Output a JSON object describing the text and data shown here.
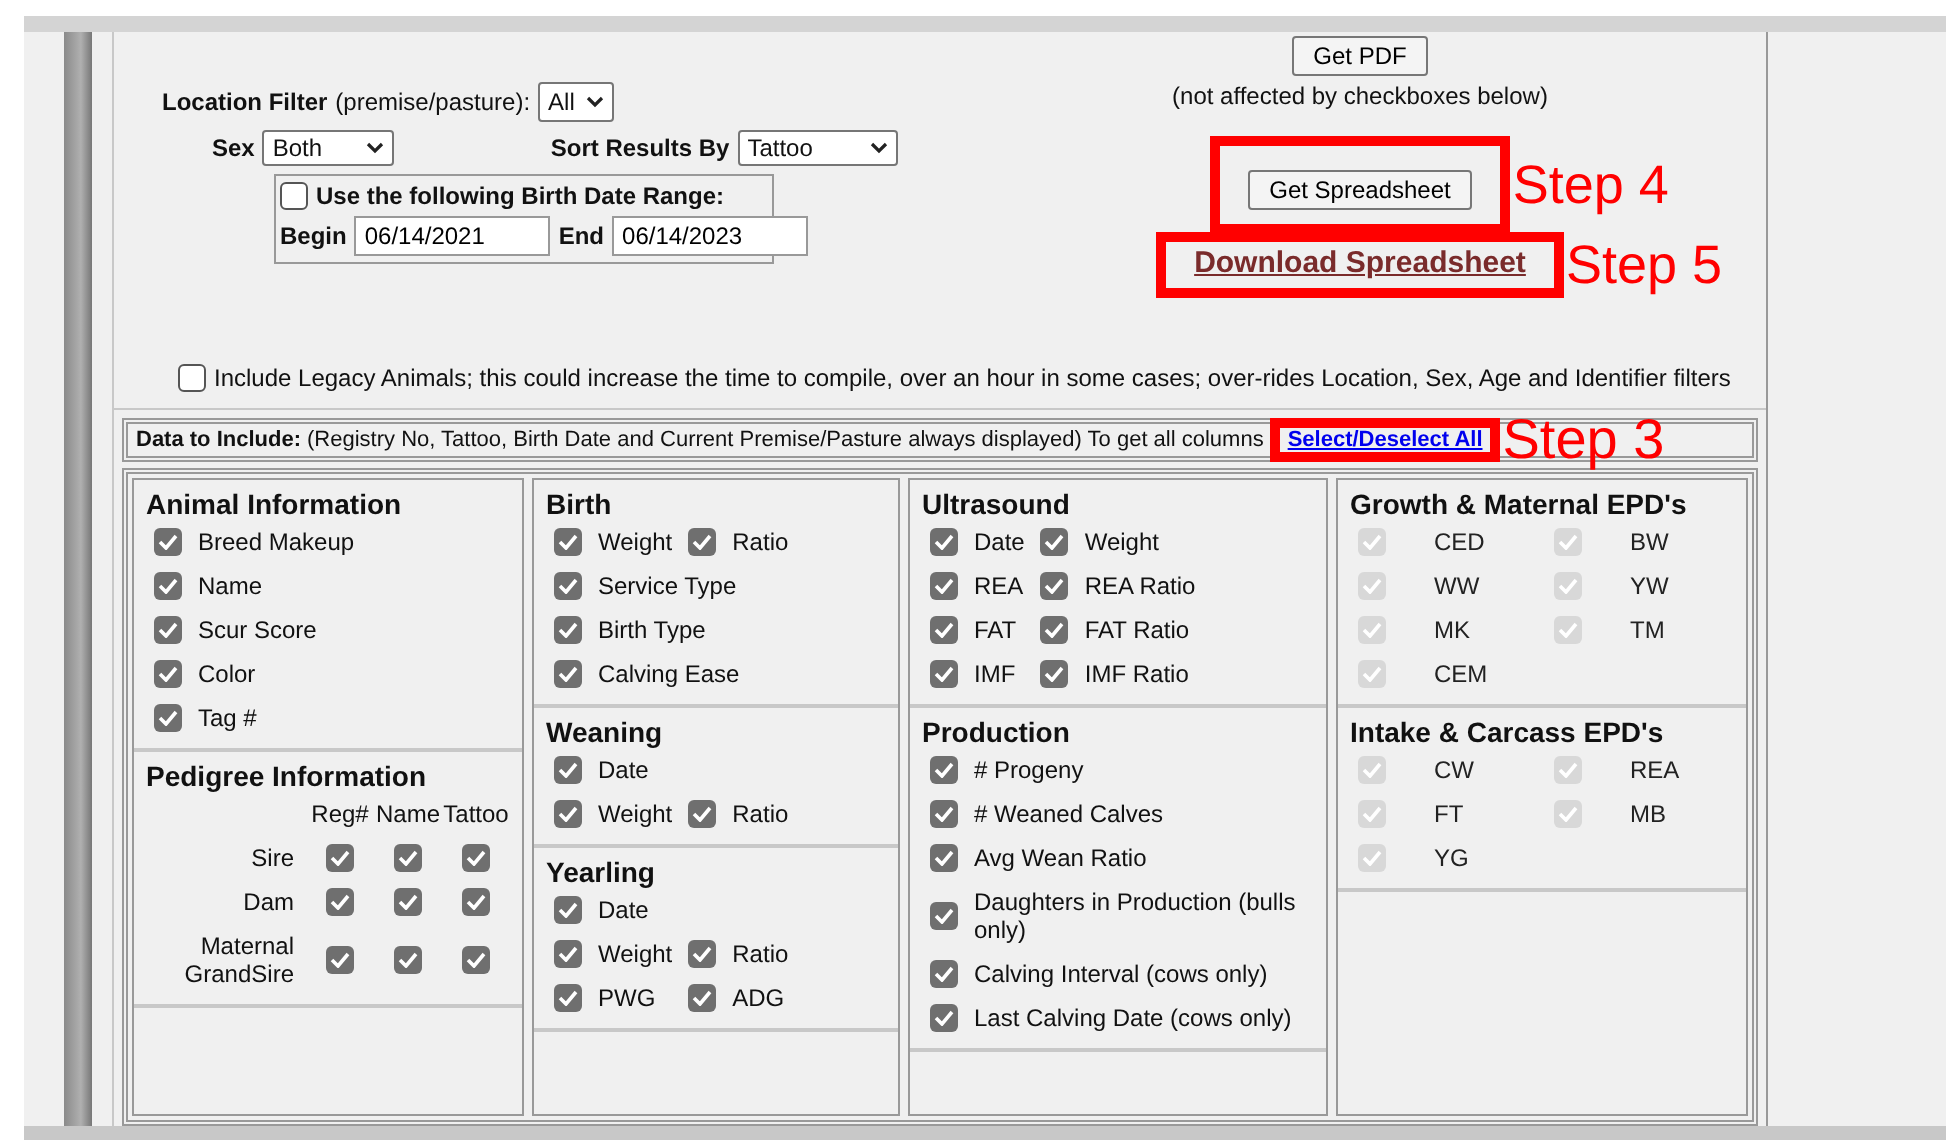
{
  "filters": {
    "location": {
      "label": "Location Filter",
      "hint": "(premise/pasture):",
      "value": "All"
    },
    "sex": {
      "label": "Sex",
      "value": "Both"
    },
    "sort": {
      "label": "Sort Results By",
      "value": "Tattoo"
    },
    "date_range": {
      "checked": false,
      "label": "Use the following Birth Date Range:",
      "begin_label": "Begin",
      "begin": "06/14/2021",
      "end_label": "End",
      "end": "06/14/2023"
    }
  },
  "pdf": {
    "button": "Get PDF",
    "note": "(not affected by checkboxes below)"
  },
  "spreadsheet": {
    "button": "Get Spreadsheet",
    "step": "Step 4"
  },
  "download": {
    "link": "Download Spreadsheet",
    "step": "Step 5"
  },
  "legacy": {
    "checked": false,
    "label": "Include Legacy Animals; this could increase the time to compile, over an hour in some cases; over-rides Location, Sex, Age and Identifier filters"
  },
  "data_to_include": {
    "label": "Data to Include:",
    "note": "(Registry No, Tattoo, Birth Date and Current Premise/Pasture always displayed) To get all columns",
    "link": "Select/Deselect All",
    "step": "Step 3"
  },
  "columns": [
    {
      "sections": [
        {
          "kind": "list",
          "title": "Animal Information",
          "disabled": false,
          "rows": [
            [
              {
                "label": "Breed Makeup",
                "checked": true
              }
            ],
            [
              {
                "label": "Name",
                "checked": true
              }
            ],
            [
              {
                "label": "Scur Score",
                "checked": true
              }
            ],
            [
              {
                "label": "Color",
                "checked": true
              }
            ],
            [
              {
                "label": "Tag #",
                "checked": true
              }
            ]
          ]
        },
        {
          "kind": "grid",
          "title": "Pedigree Information",
          "disabled": false,
          "headers": [
            "Reg#",
            "Name",
            "Tattoo"
          ],
          "rows": [
            {
              "label": "Sire",
              "checks": [
                true,
                true,
                true
              ]
            },
            {
              "label": "Dam",
              "checks": [
                true,
                true,
                true
              ]
            },
            {
              "label": "Maternal GrandSire",
              "checks": [
                true,
                true,
                true
              ]
            }
          ]
        }
      ]
    },
    {
      "sections": [
        {
          "kind": "list",
          "title": "Birth",
          "disabled": false,
          "rows": [
            [
              {
                "label": "Weight",
                "checked": true
              },
              {
                "label": "Ratio",
                "checked": true
              }
            ],
            [
              {
                "label": "Service Type",
                "checked": true
              }
            ],
            [
              {
                "label": "Birth Type",
                "checked": true
              }
            ],
            [
              {
                "label": "Calving Ease",
                "checked": true
              }
            ]
          ]
        },
        {
          "kind": "list",
          "title": "Weaning",
          "disabled": false,
          "rows": [
            [
              {
                "label": "Date",
                "checked": true
              }
            ],
            [
              {
                "label": "Weight",
                "checked": true
              },
              {
                "label": "Ratio",
                "checked": true
              }
            ]
          ]
        },
        {
          "kind": "list",
          "title": "Yearling",
          "disabled": false,
          "rows": [
            [
              {
                "label": "Date",
                "checked": true
              }
            ],
            [
              {
                "label": "Weight",
                "checked": true
              },
              {
                "label": "Ratio",
                "checked": true
              }
            ],
            [
              {
                "label": "PWG",
                "checked": true
              },
              {
                "label": "ADG",
                "checked": true
              }
            ]
          ]
        }
      ]
    },
    {
      "sections": [
        {
          "kind": "list",
          "title": "Ultrasound",
          "disabled": false,
          "rows": [
            [
              {
                "label": "Date",
                "checked": true
              },
              {
                "label": "Weight",
                "checked": true
              }
            ],
            [
              {
                "label": "REA",
                "checked": true
              },
              {
                "label": "REA Ratio",
                "checked": true
              }
            ],
            [
              {
                "label": "FAT",
                "checked": true
              },
              {
                "label": "FAT Ratio",
                "checked": true
              }
            ],
            [
              {
                "label": "IMF",
                "checked": true
              },
              {
                "label": "IMF Ratio",
                "checked": true
              }
            ]
          ]
        },
        {
          "kind": "list",
          "title": "Production",
          "disabled": false,
          "rows": [
            [
              {
                "label": "# Progeny",
                "checked": true
              }
            ],
            [
              {
                "label": "# Weaned Calves",
                "checked": true
              }
            ],
            [
              {
                "label": "Avg Wean Ratio",
                "checked": true
              }
            ],
            [
              {
                "label": "Daughters in Production (bulls only)",
                "checked": true
              }
            ],
            [
              {
                "label": "Calving Interval (cows only)",
                "checked": true
              }
            ],
            [
              {
                "label": "Last Calving Date (cows only)",
                "checked": true
              }
            ]
          ]
        }
      ]
    },
    {
      "sections": [
        {
          "kind": "epd",
          "title": "Growth & Maternal EPD's",
          "disabled": true,
          "rows": [
            [
              {
                "label": "CED",
                "checked": true
              },
              {
                "label": "BW",
                "checked": true
              }
            ],
            [
              {
                "label": "WW",
                "checked": true
              },
              {
                "label": "YW",
                "checked": true
              }
            ],
            [
              {
                "label": "MK",
                "checked": true
              },
              {
                "label": "TM",
                "checked": true
              }
            ],
            [
              {
                "label": "CEM",
                "checked": true
              }
            ]
          ]
        },
        {
          "kind": "epd",
          "title": "Intake & Carcass EPD's",
          "disabled": true,
          "rows": [
            [
              {
                "label": "CW",
                "checked": true
              },
              {
                "label": "REA",
                "checked": true
              }
            ],
            [
              {
                "label": "FT",
                "checked": true
              },
              {
                "label": "MB",
                "checked": true
              }
            ],
            [
              {
                "label": "YG",
                "checked": true
              }
            ]
          ]
        }
      ]
    }
  ]
}
